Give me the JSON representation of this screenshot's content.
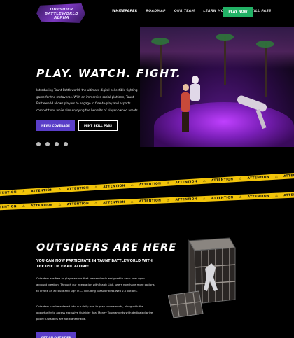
{
  "nav": {
    "logo_lines": [
      "OUTSIDER",
      "BATTLEWORLD",
      "ALPHA"
    ],
    "links": [
      "WHITEPAPER",
      "ROADMAP",
      "OUR TEAM",
      "LEARN MORE",
      "MINT SKILL PASS"
    ],
    "active_index": 0,
    "play_button": "PLAY NOW"
  },
  "hero": {
    "title": "PLAY. WATCH. FIGHT.",
    "description": "Introducing Taunt Battleworld, the ultimate digital collectible fighting game for the metaverse. With an immersive social platform, Taunt Battleworld allows players to engage in free-to-play and esports competitions while also enjoying the benefits of player-owned assets.",
    "primary_button": "NEWS COVERAGE",
    "secondary_button": "MINT SKILL PASS",
    "socials": [
      "discord-icon",
      "twitter-icon",
      "youtube-icon",
      "instagram-icon"
    ]
  },
  "tape": {
    "text": "⚠ ATTENTION ⚠ ATTENTION ⚠ ATTENTION ⚠ ATTENTION ⚠ ATTENTION ⚠ ATTENTION ⚠ ATTENTION ⚠ ATTENTION ⚠ ATTENTION ⚠ ATTENTION ⚠ ATTENTION",
    "color": "#f2c40a"
  },
  "outsiders": {
    "title": "OUTSIDERS ARE HERE",
    "subtitle": "YOU CAN NOW PARTICIPATE IN TAUNT BATTLEWORLD WITH THE USE OF EMAIL ALONE!",
    "paragraph1": "Outsiders are free-to-play warriors that are randomly assigned to each user upon account creation. Through our integration with Magic Link, users now have more options to create an account and sign in — including passwordless Web 2.0 options.",
    "paragraph2": "Outsiders can be entered into our daily free-to-play tournaments, along with the opportunity to access exclusive Outsider Real Money Tournaments with dedicated prize pools! Outsiders are not transferable.",
    "button": "GET AN OUTSIDER"
  },
  "colors": {
    "accent_green": "#22b266",
    "accent_purple": "#5a3ec8",
    "background": "#000000"
  }
}
